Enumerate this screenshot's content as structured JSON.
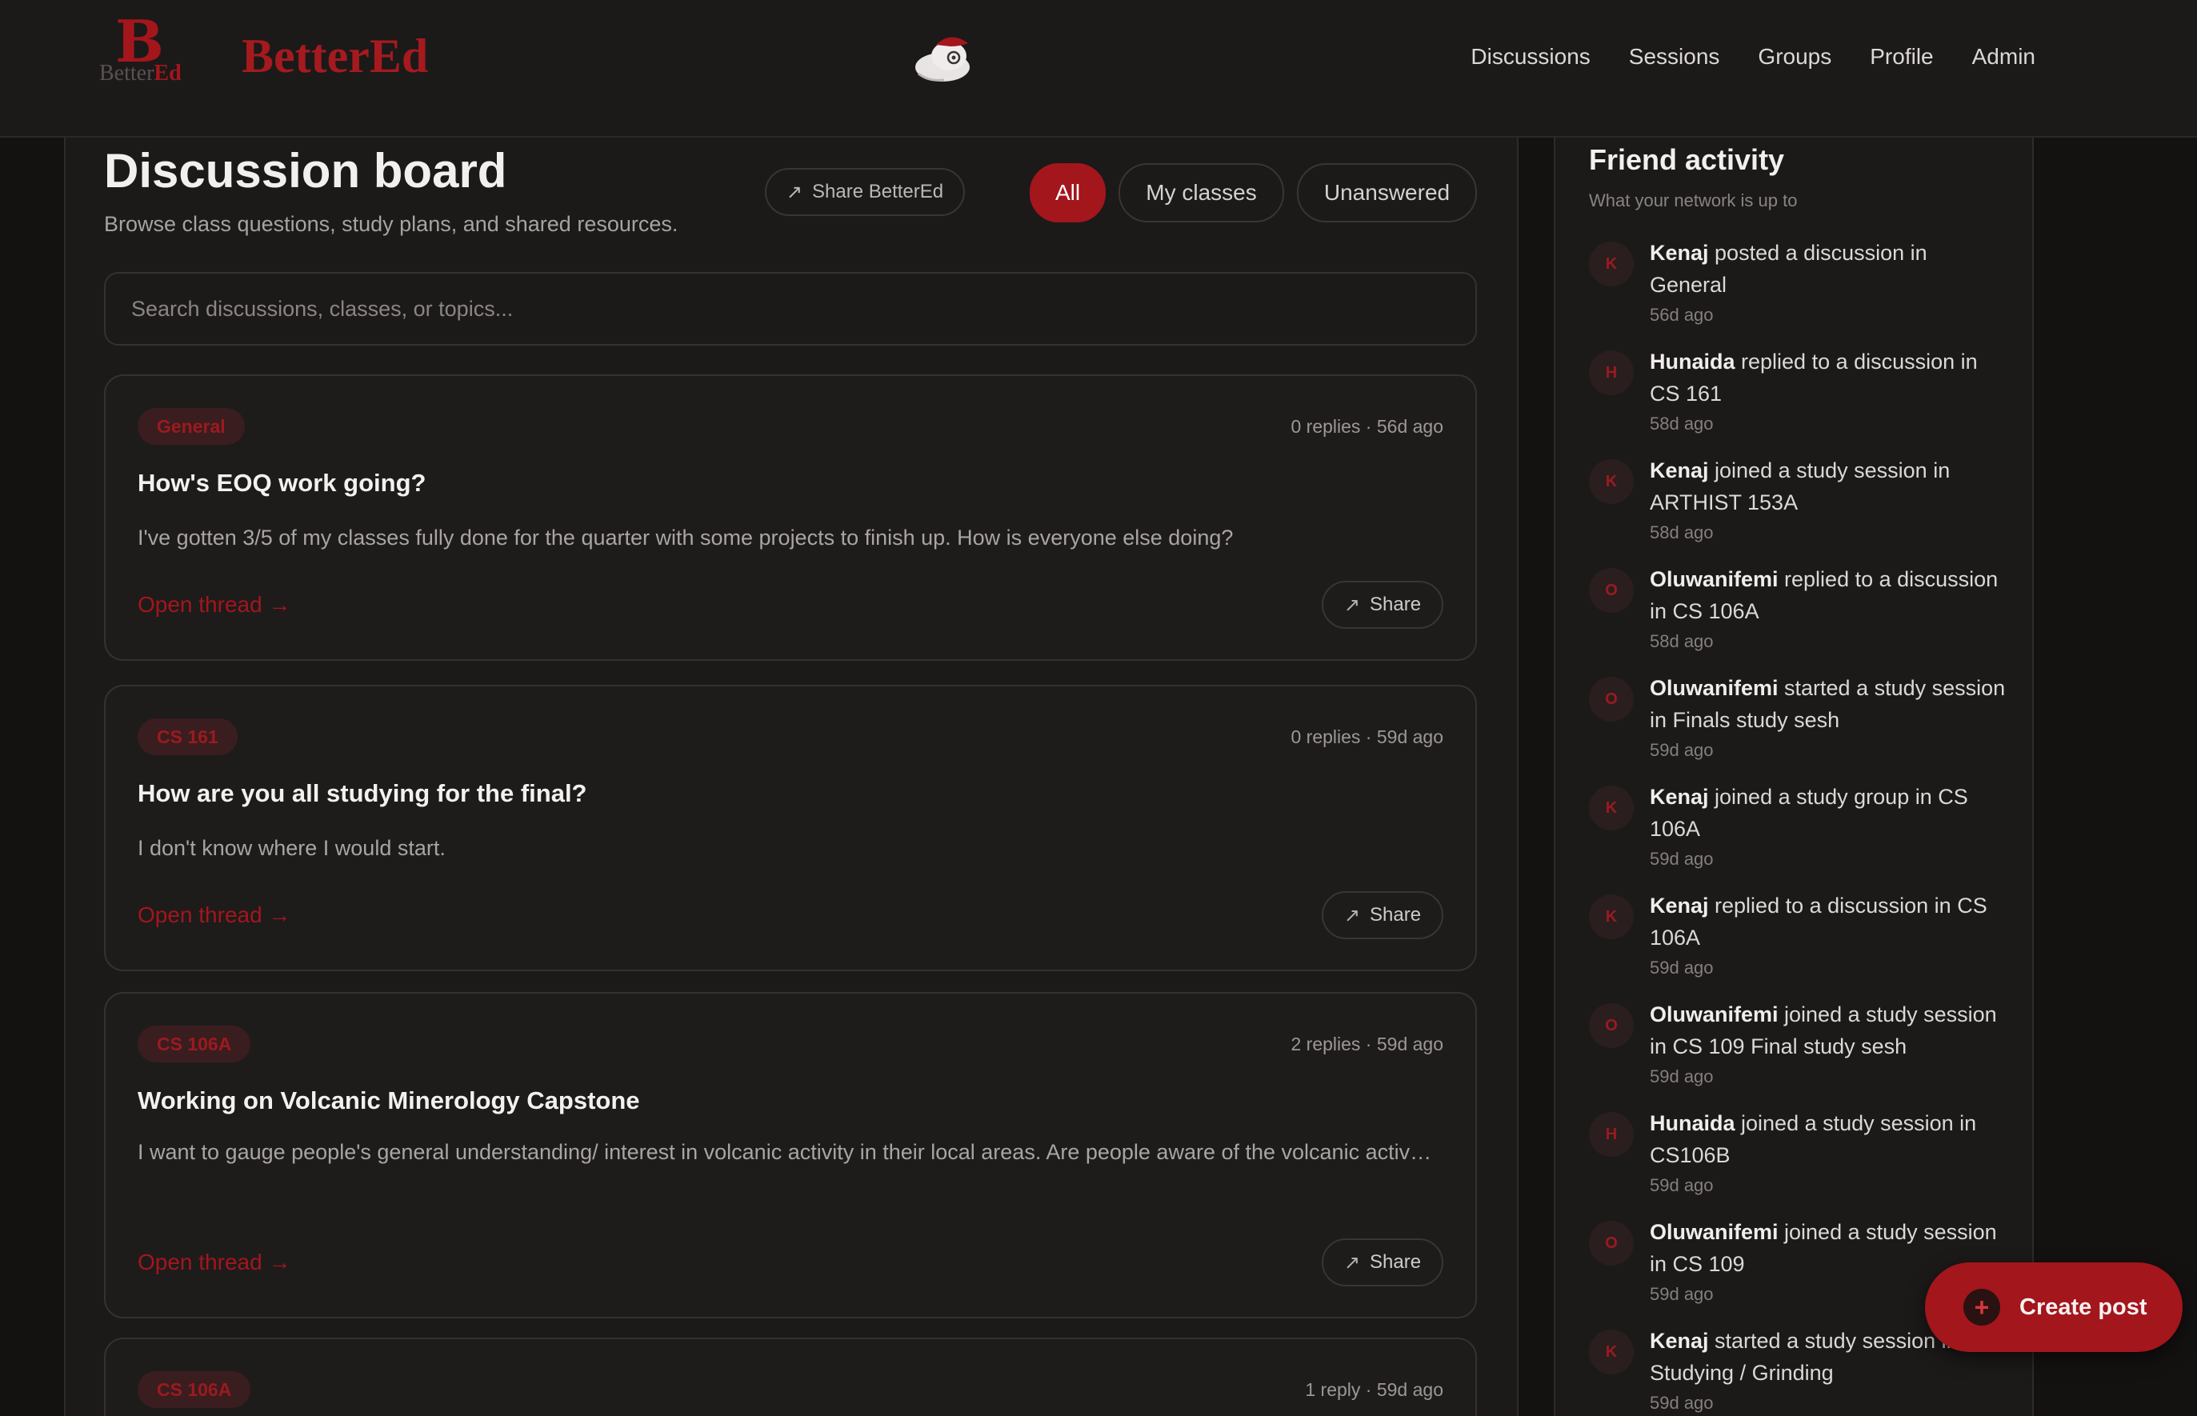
{
  "app": {
    "brand": "BetterEd",
    "logo_letter": "B",
    "logo_sub_a": "Better",
    "logo_sub_b": "Ed"
  },
  "nav": {
    "items": [
      "Discussions",
      "Sessions",
      "Groups",
      "Profile",
      "Admin"
    ]
  },
  "header": {
    "title": "Discussion board",
    "subtitle": "Browse class questions, study plans, and shared resources.",
    "share_label": "Share BetterEd"
  },
  "filters": {
    "all": "All",
    "my_classes": "My classes",
    "unanswered": "Unanswered",
    "active": "All"
  },
  "search": {
    "placeholder": "Search discussions, classes, or topics..."
  },
  "posts": [
    {
      "tag": "General",
      "meta": "0 replies · 56d ago",
      "title": "How's EOQ work going?",
      "body": "I've gotten 3/5 of my classes fully done for the quarter with some projects to finish up. How is everyone else doing?",
      "open_label": "Open thread →",
      "share_label": "Share"
    },
    {
      "tag": "CS 161",
      "meta": "0 replies · 59d ago",
      "title": "How are you all studying for the final?",
      "body": "I don't know where I would start.",
      "open_label": "Open thread →",
      "share_label": "Share"
    },
    {
      "tag": "CS 106A",
      "meta": "2 replies · 59d ago",
      "title": "Working on Volcanic Minerology Capstone",
      "body": "I want to gauge people's general understanding/ interest in volcanic activity in their local areas. Are people aware of the volcanic activ…",
      "open_label": "Open thread →",
      "share_label": "Share"
    },
    {
      "tag": "CS 106A",
      "meta": "1 reply · 59d ago"
    }
  ],
  "sidebar": {
    "title": "Friend activity",
    "subtitle": "What your network is up to",
    "items": [
      {
        "initial": "K",
        "name": "Kenaj",
        "action": " posted a discussion in General",
        "time": "56d ago"
      },
      {
        "initial": "H",
        "name": "Hunaida",
        "action": " replied to a discussion in CS 161",
        "time": "58d ago"
      },
      {
        "initial": "K",
        "name": "Kenaj",
        "action": " joined a study session in ARTHIST 153A",
        "time": "58d ago"
      },
      {
        "initial": "O",
        "name": "Oluwanifemi",
        "action": " replied to a discussion in CS 106A",
        "time": "58d ago"
      },
      {
        "initial": "O",
        "name": "Oluwanifemi",
        "action": " started a study session in Finals study sesh",
        "time": "59d ago"
      },
      {
        "initial": "K",
        "name": "Kenaj",
        "action": " joined a study group in CS 106A",
        "time": "59d ago"
      },
      {
        "initial": "K",
        "name": "Kenaj",
        "action": " replied to a discussion in CS 106A",
        "time": "59d ago"
      },
      {
        "initial": "O",
        "name": "Oluwanifemi",
        "action": " joined a study session in CS 109 Final study sesh",
        "time": "59d ago"
      },
      {
        "initial": "H",
        "name": "Hunaida",
        "action": " joined a study session in CS106B",
        "time": "59d ago"
      },
      {
        "initial": "O",
        "name": "Oluwanifemi",
        "action": " joined a study session in CS 109",
        "time": "59d ago"
      },
      {
        "initial": "K",
        "name": "Kenaj",
        "action": " started a study session in Studying / Grinding",
        "time": "59d ago"
      }
    ]
  },
  "fab": {
    "icon": "plus-icon",
    "label": "Create post"
  },
  "colors": {
    "accent": "#a3161c",
    "background": "#141111",
    "panel": "#1c1919"
  }
}
